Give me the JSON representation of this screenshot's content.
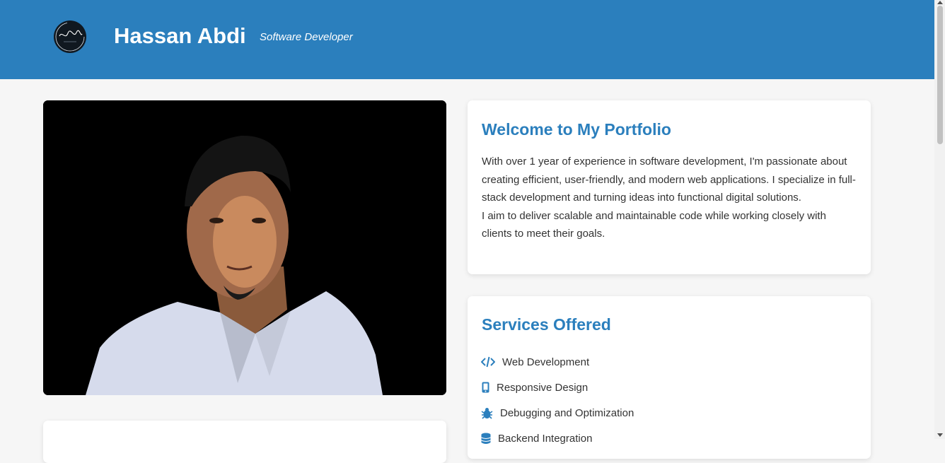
{
  "header": {
    "logo_icon": "signature-logo-icon",
    "name": "Hassan Abdi",
    "tagline": "Software Developer"
  },
  "welcome": {
    "title": "Welcome to My Portfolio",
    "paragraph": "With over 1 year of experience in software development, I'm passionate about creating efficient, user-friendly, and modern web applications. I specialize in full-stack development and turning ideas into functional digital solutions.",
    "paragraph2": "I aim to deliver scalable and maintainable code while working closely with clients to meet their goals."
  },
  "services": {
    "title": "Services Offered",
    "items": [
      {
        "label": "Web Development",
        "icon": "code-icon"
      },
      {
        "label": "Responsive Design",
        "icon": "mobile-icon"
      },
      {
        "label": "Debugging and Optimization",
        "icon": "bug-icon"
      },
      {
        "label": "Backend Integration",
        "icon": "database-icon"
      }
    ]
  },
  "colors": {
    "brand": "#2b7fbd",
    "page_background": "#f6f6f6",
    "card_background": "#ffffff"
  }
}
